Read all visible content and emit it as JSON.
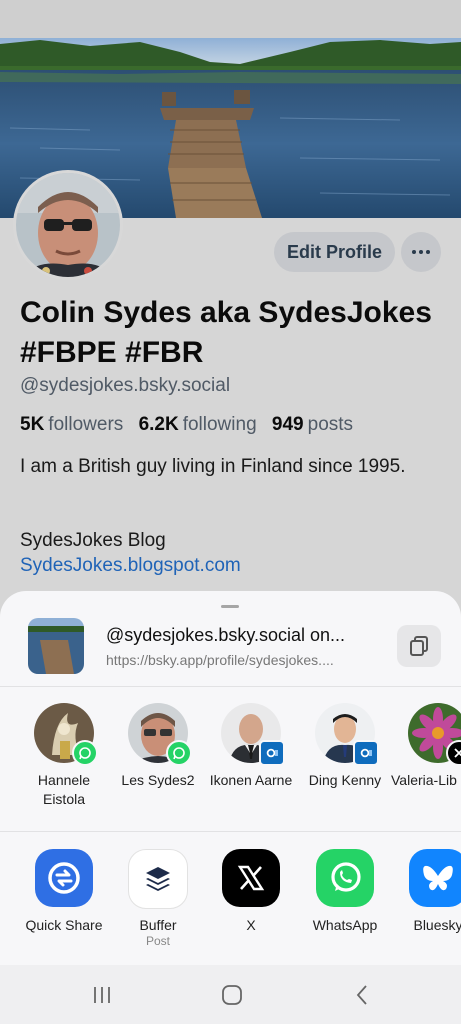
{
  "profile": {
    "edit_label": "Edit Profile",
    "more_label": "···",
    "display_name": "Colin Sydes aka SydesJokes #FBPE #FBR",
    "handle": "@sydesjokes.bsky.social",
    "followers_count": "5K",
    "followers_label": "followers",
    "following_count": "6.2K",
    "following_label": "following",
    "posts_count": "949",
    "posts_label": "posts",
    "bio": "I am a British guy living in Finland since 1995.",
    "blog_title": "SydesJokes Blog",
    "blog_link": "SydesJokes.blogspot.com"
  },
  "share": {
    "title": "@sydesjokes.bsky.social on...",
    "url": "https://bsky.app/profile/sydesjokes....",
    "contacts": [
      {
        "name": "Hannele Eistola",
        "badge": "whatsapp-icon",
        "badge_color": "#25d366"
      },
      {
        "name": "Les Sydes2",
        "badge": "whatsapp-icon",
        "badge_color": "#25d366"
      },
      {
        "name": "Ikonen Aarne",
        "badge": "outlook-icon",
        "badge_color": "#0f6cbd"
      },
      {
        "name": "Ding Kenny",
        "badge": "outlook-icon",
        "badge_color": "#0f6cbd"
      },
      {
        "name": "Valeria-Lib mNAFOFe",
        "badge": "x-icon",
        "badge_color": "#000000"
      }
    ],
    "apps": [
      {
        "name": "Quick Share",
        "sub": "",
        "icon": "quick-share-icon",
        "color": "#2f6fe4"
      },
      {
        "name": "Buffer",
        "sub": "Post",
        "icon": "buffer-icon",
        "color": "#ffffff"
      },
      {
        "name": "X",
        "sub": "",
        "icon": "x-icon",
        "color": "#000000"
      },
      {
        "name": "WhatsApp",
        "sub": "",
        "icon": "whatsapp-icon",
        "color": "#25d366"
      },
      {
        "name": "Bluesky",
        "sub": "",
        "icon": "bluesky-icon",
        "color": "#1185fe"
      }
    ]
  },
  "colors": {
    "link": "#1f63b7",
    "sheet_bg": "#f7f7f9"
  }
}
